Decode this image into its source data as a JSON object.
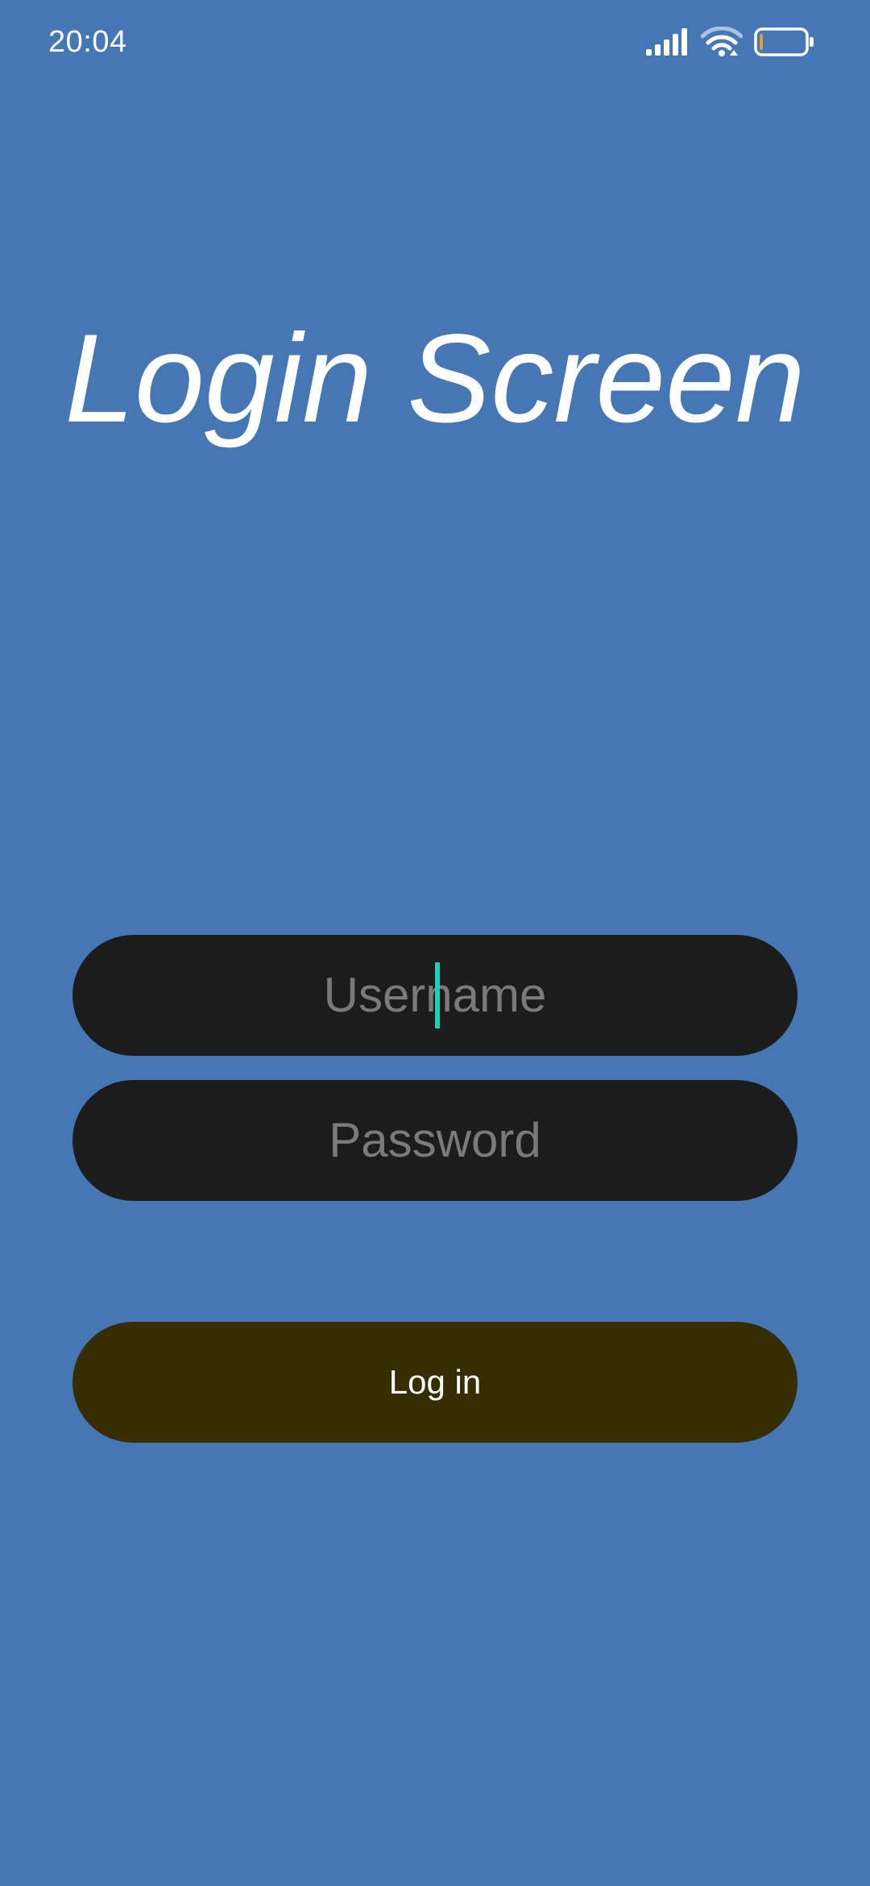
{
  "status_bar": {
    "time": "20:04",
    "icons": [
      "signal-icon",
      "wifi-icon",
      "battery-icon"
    ]
  },
  "title": "Login Screen",
  "form": {
    "username_placeholder": "Username",
    "password_placeholder": "Password",
    "login_label": "Log in"
  },
  "colors": {
    "background": "#4477b3",
    "field_background": "#1c1c1c",
    "placeholder": "#7a7a7a",
    "cursor": "#1fd0b8",
    "button_background": "#362e02",
    "battery_low": "#e0a030"
  }
}
